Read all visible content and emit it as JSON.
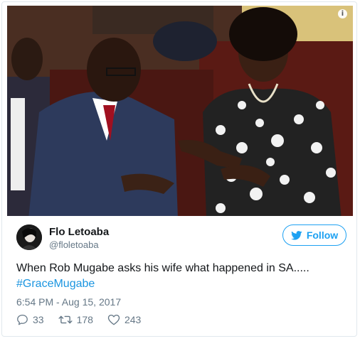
{
  "photo": {
    "alt_icon": "info-icon",
    "info_glyph": "i"
  },
  "author": {
    "display_name": "Flo Letoaba",
    "handle": "@floletoaba",
    "avatar_icon": "avatar"
  },
  "follow": {
    "label": "Follow",
    "icon": "twitter-bird-icon",
    "color": "#1da1f2"
  },
  "tweet": {
    "text": "When Rob Mugabe asks his wife what happened in SA.....",
    "hashtag": "#GraceMugabe",
    "timestamp": "6:54 PM - Aug 15, 2017"
  },
  "actions": {
    "replies": "33",
    "retweets": "178",
    "likes": "243"
  },
  "colors": {
    "link": "#1b95e0",
    "muted": "#657786",
    "border": "#e1e8ed"
  }
}
